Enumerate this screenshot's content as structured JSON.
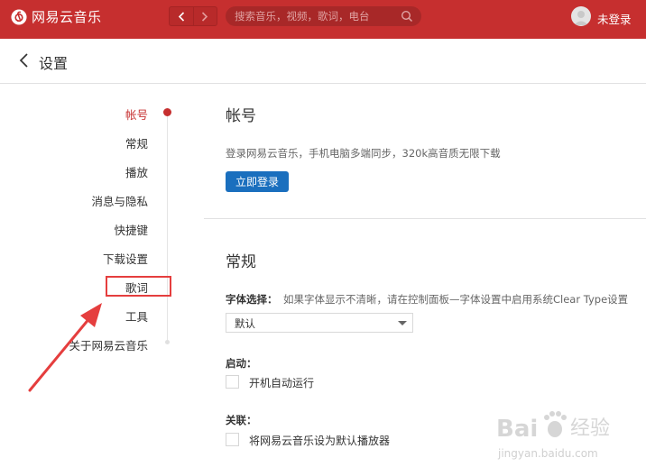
{
  "app": {
    "name": "网易云音乐"
  },
  "search": {
    "placeholder": "搜索音乐，视频，歌词，电台"
  },
  "user": {
    "login_label": "未登录"
  },
  "page": {
    "title": "设置"
  },
  "nav": {
    "items": [
      "帐号",
      "常规",
      "播放",
      "消息与隐私",
      "快捷键",
      "下载设置",
      "歌词",
      "工具",
      "关于网易云音乐"
    ],
    "active_index": 0
  },
  "account": {
    "title": "帐号",
    "description": "登录网易云音乐，手机电脑多端同步，320k高音质无限下载",
    "login_button": "立即登录"
  },
  "general": {
    "title": "常规",
    "font_label": "字体选择：",
    "font_hint": "如果字体显示不清晰，请在控制面板—字体设置中启用系统Clear Type设置",
    "font_value": "默认",
    "startup_label": "启动：",
    "startup_option": "开机自动运行",
    "assoc_label": "关联：",
    "assoc_option": "将网易云音乐设为默认播放器"
  },
  "watermark": {
    "brand": "Bai",
    "brand_cn": "经验",
    "url": "jingyan.baidu.com"
  },
  "colors": {
    "brand_red": "#c62f2f",
    "button_blue": "#1a6fbe",
    "highlight_red": "#e53e3e"
  },
  "icons": [
    "netease-music-logo-icon",
    "back-arrow-icon",
    "forward-arrow-icon",
    "search-icon",
    "avatar-icon",
    "chevron-left-icon",
    "dropdown-caret-icon",
    "annotation-arrow-icon",
    "baidu-paw-icon"
  ]
}
